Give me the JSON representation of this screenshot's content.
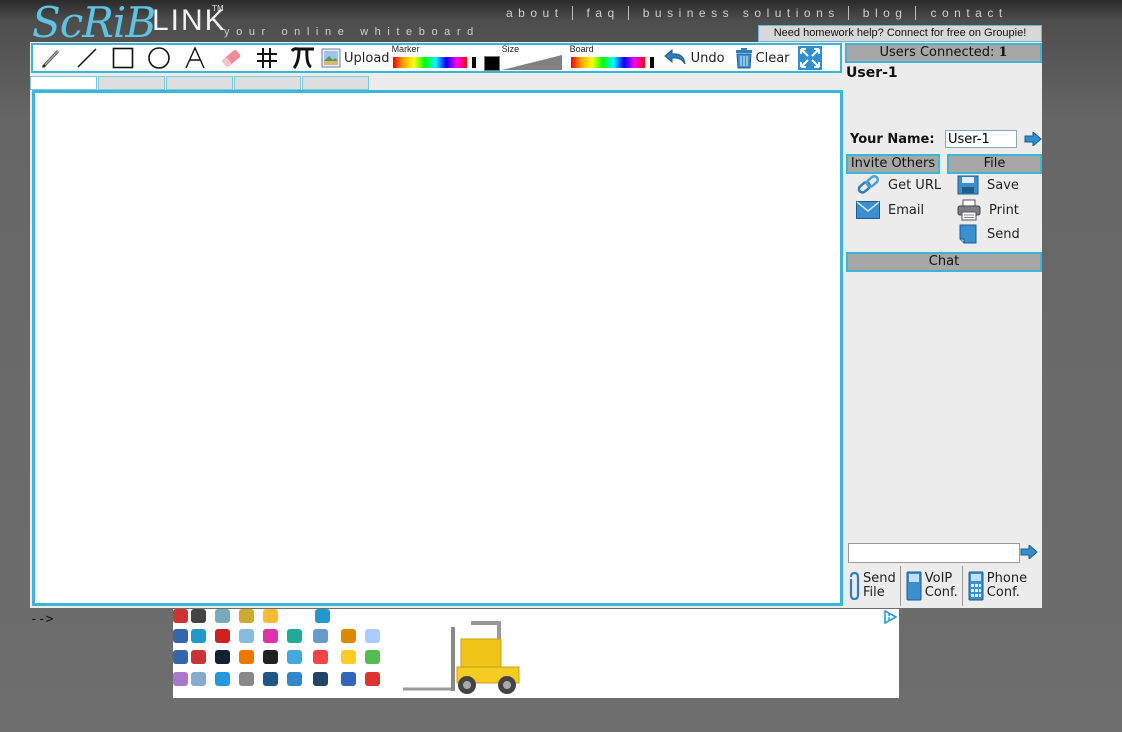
{
  "header": {
    "logo_word": "ScRiB",
    "logo_link": "LINK",
    "logo_tm": "TM",
    "tagline": "your online whiteboard",
    "nav": [
      "about",
      "faq",
      "business solutions",
      "blog",
      "contact"
    ],
    "promo": "Need homework help? Connect for free on Groupie!"
  },
  "toolbar": {
    "upload_label": "Upload",
    "marker_label": "Marker",
    "size_label": "Size",
    "board_label": "Board",
    "undo_label": "Undo",
    "clear_label": "Clear",
    "marker_color": "#000000",
    "tabs_count_visible": 5
  },
  "sidebar": {
    "users_connected_label": "Users Connected:",
    "users_connected_count": "1",
    "users": [
      "User-1"
    ],
    "your_name_label": "Your Name:",
    "your_name_value": "User-1",
    "invite_header": "Invite Others",
    "file_header": "File",
    "invite_actions": [
      "Get URL",
      "Email"
    ],
    "file_actions": [
      "Save",
      "Print",
      "Send"
    ],
    "chat_header": "Chat",
    "bottom": [
      {
        "line1": "Send",
        "line2": "File"
      },
      {
        "line1": "VoIP",
        "line2": "Conf."
      },
      {
        "line1": "Phone",
        "line2": "Conf."
      }
    ]
  },
  "footer": {
    "comment_artifact": "-->"
  },
  "colors": {
    "accent": "#3cb6d6",
    "header_bar": "#a7a7a7",
    "panel": "#ececec"
  }
}
